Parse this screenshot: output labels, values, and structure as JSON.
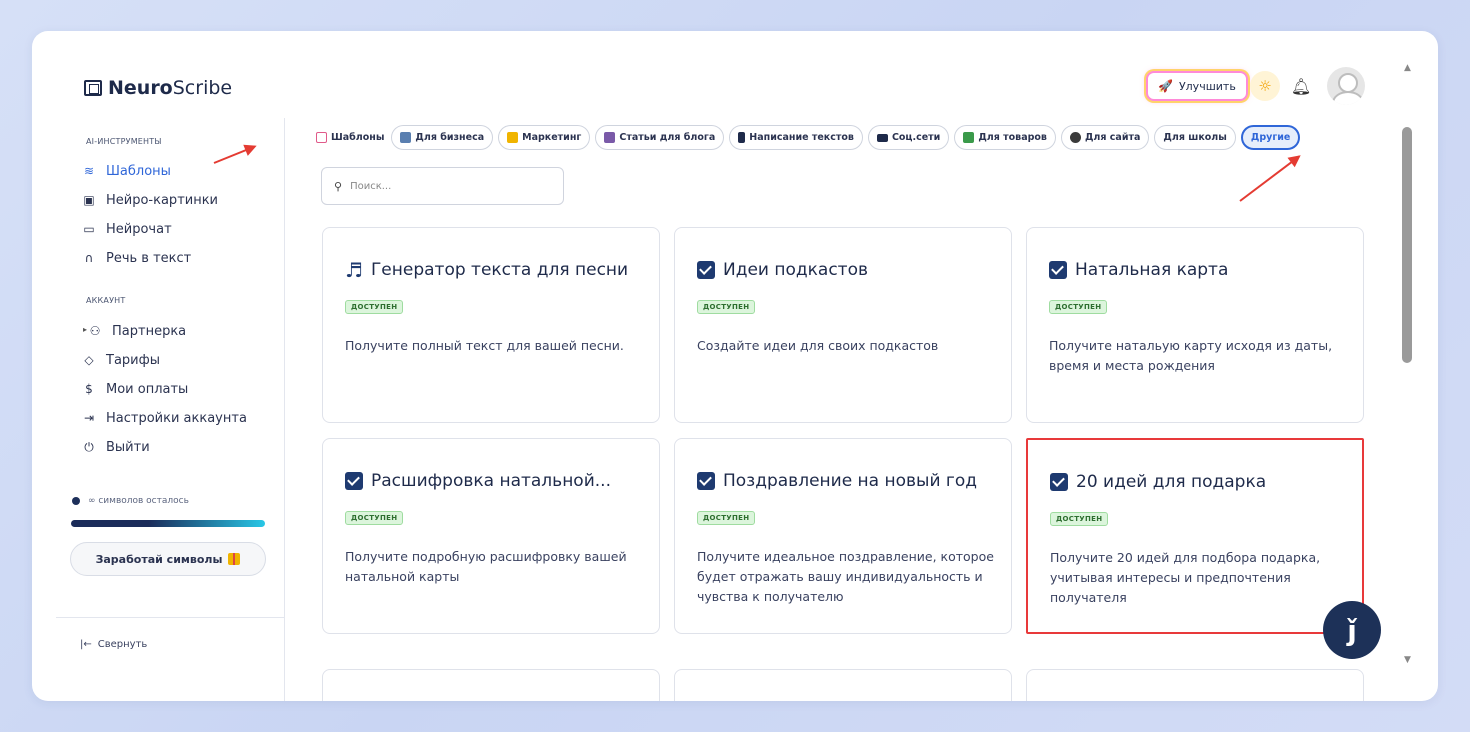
{
  "header": {
    "logo_bold": "Neuro",
    "logo_light": "Scribe",
    "upgrade_label": "Улучшить"
  },
  "sidebar": {
    "section_tools": "AI-ИНСТРУМЕНТЫ",
    "tools": [
      {
        "label": "Шаблоны",
        "icon": "layers-icon"
      },
      {
        "label": "Нейро-картинки",
        "icon": "image-icon"
      },
      {
        "label": "Нейрочат",
        "icon": "chat-icon"
      },
      {
        "label": "Речь в текст",
        "icon": "headphones-icon"
      }
    ],
    "section_account": "АККАУНТ",
    "account": [
      {
        "label": "Партнерка",
        "icon": "users-icon"
      },
      {
        "label": "Тарифы",
        "icon": "tag-icon"
      },
      {
        "label": "Мои оплаты",
        "icon": "dollar-icon"
      },
      {
        "label": "Настройки аккаунта",
        "icon": "login-icon"
      },
      {
        "label": "Выйти",
        "icon": "power-icon"
      }
    ],
    "symbols_text": "∞ символов осталось",
    "earn_label": "Заработай символы",
    "collapse_label": "Свернуть"
  },
  "chips": [
    {
      "label": "Шаблоны",
      "color": "#e05a8a"
    },
    {
      "label": "Для бизнеса",
      "color": "#5a7fb0"
    },
    {
      "label": "Маркетинг",
      "color": "#f0b400"
    },
    {
      "label": "Статьи для блога",
      "color": "#7a5aa8"
    },
    {
      "label": "Написание текстов",
      "color": "#1e2a4a"
    },
    {
      "label": "Соц.сети",
      "color": "#1e2a4a"
    },
    {
      "label": "Для товаров",
      "color": "#3a9a4a"
    },
    {
      "label": "Для сайта",
      "color": "#3a3a3a"
    },
    {
      "label": "Для школы",
      "color": ""
    },
    {
      "label": "Другие",
      "color": ""
    }
  ],
  "search": {
    "placeholder": "Поиск..."
  },
  "badge_text": "ДОСТУПЕН",
  "cards": [
    {
      "title": "Генератор текста для песни",
      "icon": "music-note-icon",
      "desc": "Получите полный текст для вашей песни."
    },
    {
      "title": "Идеи подкастов",
      "icon": "checkbox-icon",
      "desc": "Создайте идеи для своих подкастов"
    },
    {
      "title": "Натальная карта",
      "icon": "checkbox-icon",
      "desc": "Получите натальую карту исходя из даты, время и места рождения"
    },
    {
      "title": "Расшифровка натальной...",
      "icon": "checkbox-icon",
      "desc": "Получите подробную расшифровку вашей натальной карты"
    },
    {
      "title": "Поздравление на новый год",
      "icon": "checkbox-icon",
      "desc": "Получите идеальное поздравление, которое будет отражать вашу индивидуальность и чувства к получателю"
    },
    {
      "title": "20 идей для подарка",
      "icon": "checkbox-icon",
      "desc": "Получите 20 идей для подбора подарка, учитывая интересы и предпочтения получателя"
    }
  ],
  "colors": {
    "accent": "#2f66d8",
    "highlight": "#e8393a",
    "badge_bg": "#dcf5dc",
    "fab": "#1d3158"
  }
}
